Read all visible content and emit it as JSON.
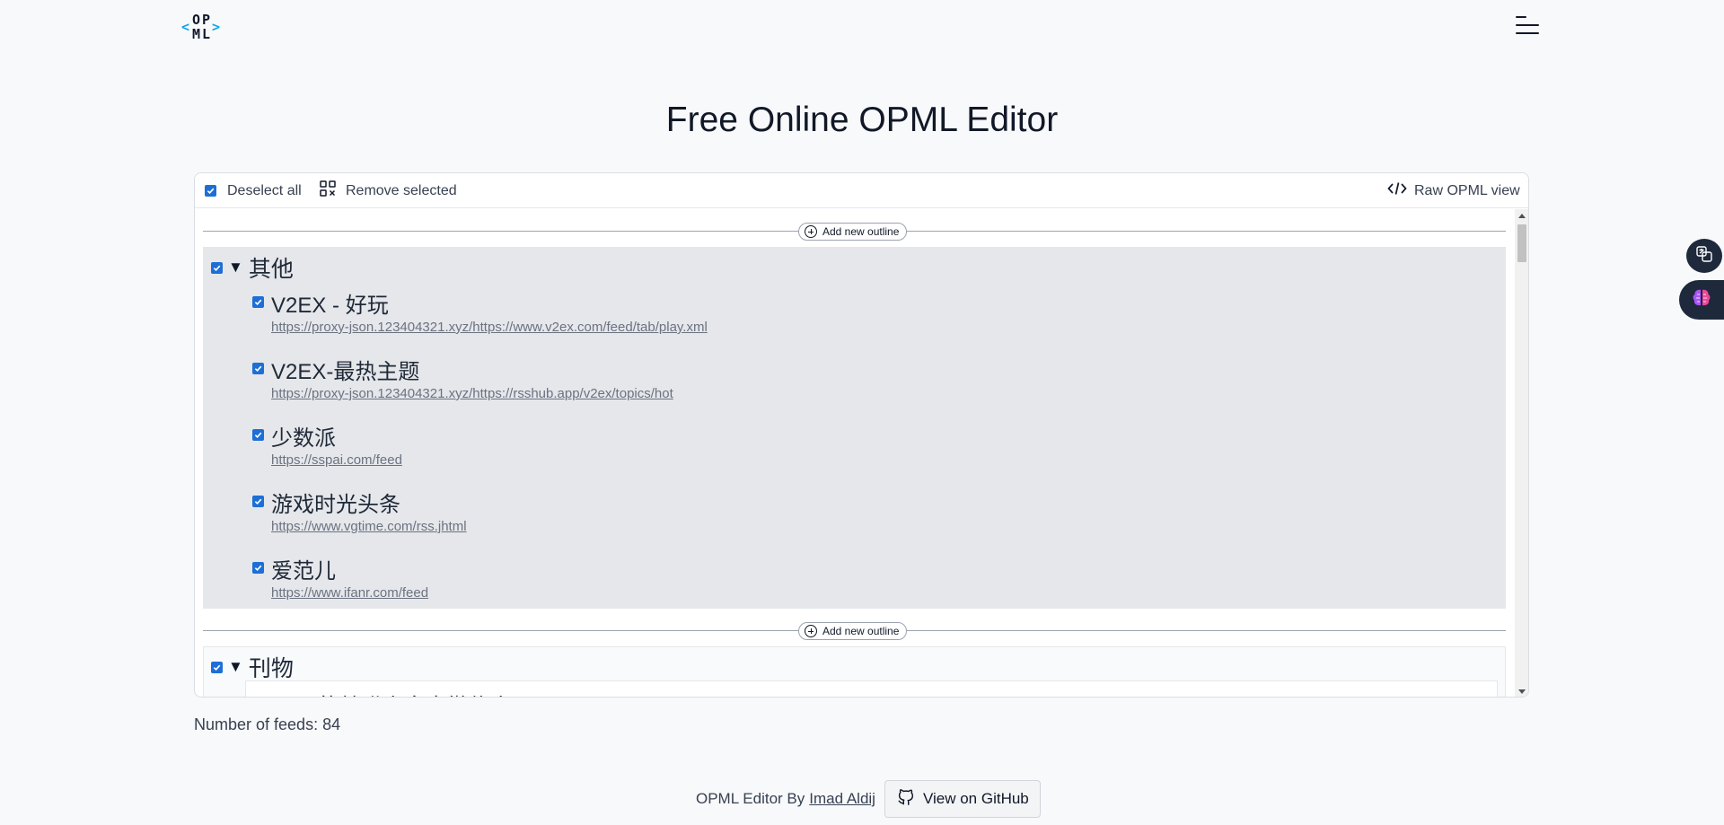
{
  "header": {
    "logo_top": "OP",
    "logo_bottom": "ML"
  },
  "page": {
    "title": "Free Online OPML Editor"
  },
  "toolbar": {
    "deselect_all": "Deselect all",
    "remove_selected": "Remove selected",
    "raw_view": "Raw OPML view"
  },
  "outline": {
    "add_label": "Add new outline",
    "groups": [
      {
        "title": "其他",
        "feeds": [
          {
            "title": "V2EX - 好玩",
            "url": "https://proxy-json.123404321.xyz/https://www.v2ex.com/feed/tab/play.xml"
          },
          {
            "title": "V2EX-最热主题",
            "url": "https://proxy-json.123404321.xyz/https://rsshub.app/v2ex/topics/hot"
          },
          {
            "title": "少数派",
            "url": "https://sspai.com/feed"
          },
          {
            "title": "游戏时光头条",
            "url": "https://www.vgtime.com/rss.jhtml"
          },
          {
            "title": "爱范儿",
            "url": "https://www.ifanr.com/feed"
          }
        ]
      },
      {
        "title": "刊物",
        "feeds": [
          {
            "title": "caoz的梦呓丨自由微信丨FreeWeChat",
            "url": ""
          }
        ]
      }
    ]
  },
  "stats": {
    "feeds_count": "Number of feeds: 84"
  },
  "footer": {
    "by_text": "OPML Editor By",
    "author": "Imad Aldij",
    "github_button": "View on GitHub"
  },
  "colors": {
    "accent": "#1d6fd6",
    "logo_bracket": "#0ea5e9",
    "group_bg": "#e5e7eb"
  },
  "icons": [
    "menu-icon",
    "qr-remove-icon",
    "code-icon",
    "plus-circle-icon",
    "github-icon",
    "translate-icon",
    "brain-icon"
  ]
}
